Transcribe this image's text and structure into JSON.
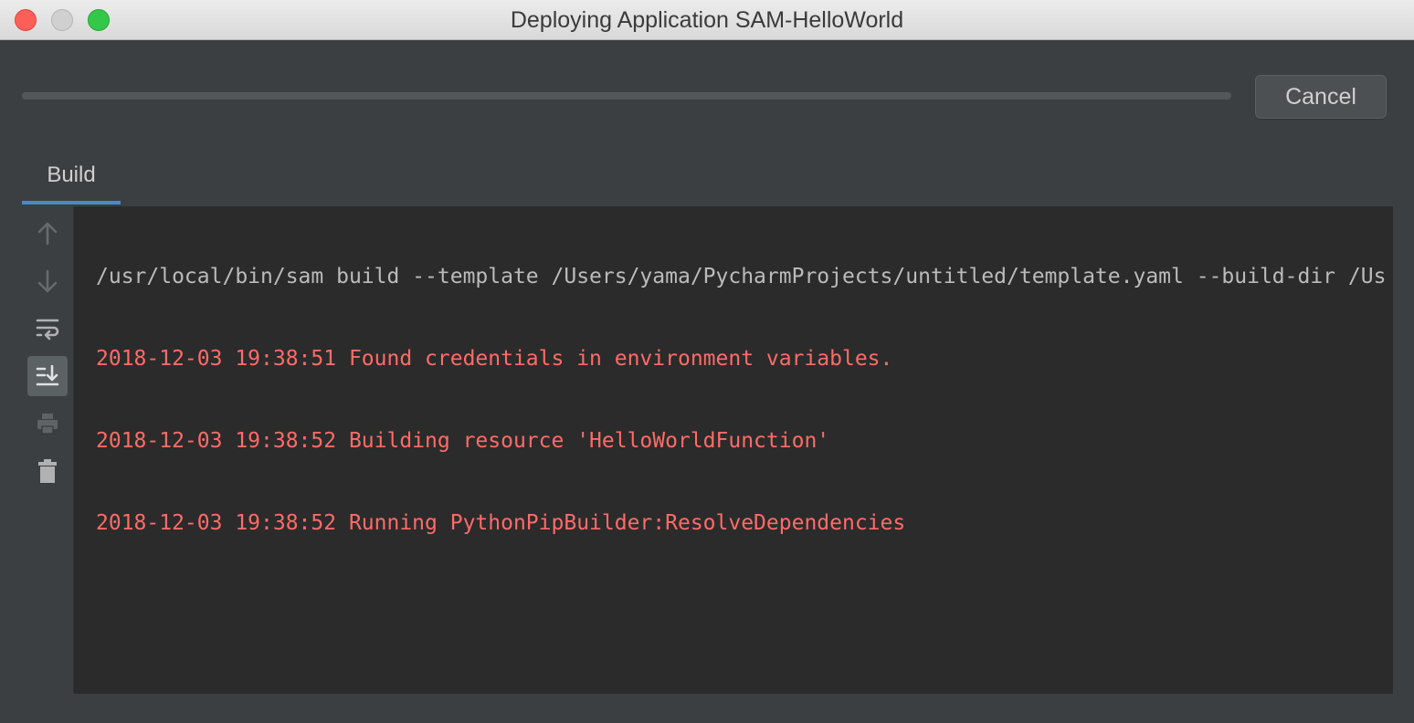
{
  "window": {
    "title": "Deploying Application SAM-HelloWorld"
  },
  "progress": {
    "cancel_label": "Cancel"
  },
  "tabs": [
    {
      "label": "Build",
      "active": true
    }
  ],
  "toolbar": {
    "icons": [
      "up-arrow-icon",
      "down-arrow-icon",
      "soft-wrap-icon",
      "scroll-to-end-icon",
      "print-icon",
      "trash-icon"
    ]
  },
  "console": {
    "lines": [
      {
        "kind": "cmd",
        "text": "/usr/local/bin/sam build --template /Users/yama/PycharmProjects/untitled/template.yaml --build-dir /Us"
      },
      {
        "kind": "err",
        "text": "2018-12-03 19:38:51 Found credentials in environment variables."
      },
      {
        "kind": "err",
        "text": "2018-12-03 19:38:52 Building resource 'HelloWorldFunction'"
      },
      {
        "kind": "err",
        "text": "2018-12-03 19:38:52 Running PythonPipBuilder:ResolveDependencies"
      }
    ]
  },
  "colors": {
    "accent": "#4a88c7",
    "error_text": "#ff6b68",
    "command_text": "#bbbbbb",
    "console_bg": "#2b2b2b",
    "panel_bg": "#3c3f41"
  }
}
